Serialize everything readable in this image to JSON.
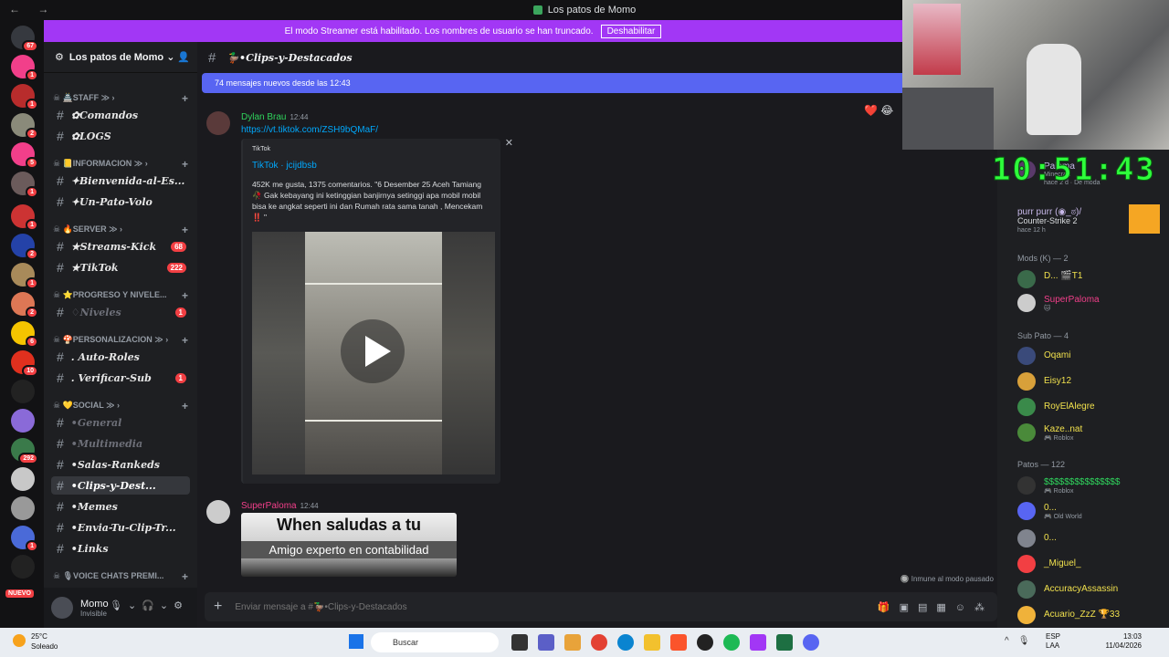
{
  "window": {
    "title": "Los patos de Momo",
    "nav": "← →"
  },
  "streamer_bar": {
    "text": "El modo Streamer está habilitado. Los nombres de usuario se han truncado.",
    "button": "Deshabilitar"
  },
  "server": {
    "name": "Los patos de Momo ⌄"
  },
  "guild_badges": [
    "67",
    "1",
    "1",
    "2",
    "5",
    "1",
    "1",
    "2",
    "1",
    "2",
    "6",
    "10",
    "292",
    "1"
  ],
  "guild_new": "NUEVO",
  "categories": [
    {
      "label": "☠ 🏯STAFF ≫ ›"
    },
    {
      "label": "☠ 📒INFORMACION ≫ ›"
    },
    {
      "label": "☠ 🔥SERVER ≫ ›"
    },
    {
      "label": "☠ ⭐PROGRESO Y NIVELE..."
    },
    {
      "label": "☠ 🍄PERSONALIZACION ≫ ›"
    },
    {
      "label": "☠ 💛SOCIAL ≫ ›"
    },
    {
      "label": "☠ 🎙VOICE CHATS PREMI..."
    }
  ],
  "channels": [
    {
      "label": "✿Comandos",
      "count": ""
    },
    {
      "label": "✿LOGS",
      "count": ""
    },
    {
      "label": "✦Bienvenida-al-Es...",
      "count": ""
    },
    {
      "label": "✦Un-Pato-Volo",
      "count": ""
    },
    {
      "label": "★Streams-Kick",
      "count": "68"
    },
    {
      "label": "★TikTok",
      "count": "222"
    },
    {
      "label": "♢Niveles",
      "count": "1"
    },
    {
      "label": ". Auto-Roles",
      "count": ""
    },
    {
      "label": ". Verificar-Sub",
      "count": "1"
    },
    {
      "label": "•General",
      "count": ""
    },
    {
      "label": "•Multimedia",
      "count": ""
    },
    {
      "label": "•Salas-Rankeds",
      "count": ""
    },
    {
      "label": "•Clips-y-Dest...",
      "count": ""
    },
    {
      "label": "•Memes",
      "count": ""
    },
    {
      "label": "•Envia-Tu-Clip-Tr...",
      "count": ""
    },
    {
      "label": "•Links",
      "count": ""
    }
  ],
  "user": {
    "name": "Momo",
    "status": "Invisible"
  },
  "chat": {
    "channel": "🦆•Clips-y-Destacados",
    "new_messages": "74 mensajes nuevos desde las 12:43",
    "msg1": {
      "author": "Dylan Brau",
      "time": "12:44",
      "link": "https://vt.tiktok.com/ZSH9bQMaF/",
      "provider": "TikTok",
      "embed_title": "TikTok · jcijdbsb",
      "embed_desc": "452K me gusta, 1375 comentarios. \"6 Desember 25 Aceh Tamiang 🥀 Gak kebayang ini ketinggian banjirnya setinggi apa mobil mobil bisa ke angkat seperti ini dan Rumah rata sama tanah , Mencekam ‼️ \""
    },
    "msg2": {
      "author": "SuperPaloma",
      "time": "12:44",
      "meme_line1": "When saludas a tu",
      "meme_line2": "Amigo experto en contabilidad"
    },
    "reactions": "❤️ 😂",
    "immune": "🔘 Inmune al modo pausado",
    "composer_placeholder": "Enviar mensaje a #🦆•Clips-y-Destacados"
  },
  "clock": "10:51:43",
  "members": {
    "top": [
      {
        "name": "Paloma",
        "sub": "Minecraft",
        "sub2": "hace 2 d · De moda"
      },
      {
        "name": "purr purr (◉_ಠ)/",
        "sub": "Counter-Strike 2",
        "sub2": "hace 12 h"
      }
    ],
    "groups": [
      {
        "title": "Mods (K) — 2",
        "items": [
          {
            "name": "D... 🎬T1",
            "sub": "",
            "color": "#f0e04d"
          },
          {
            "name": "SuperPaloma",
            "sub": "🐱",
            "color": "#f23f8a"
          }
        ]
      },
      {
        "title": "Sub Pato — 4",
        "items": [
          {
            "name": "Oqami",
            "sub": "",
            "color": "#f0e04d"
          },
          {
            "name": "Eisy12",
            "sub": "",
            "color": "#f0e04d"
          },
          {
            "name": "RoyElAlegre",
            "sub": "",
            "color": "#f0e04d"
          },
          {
            "name": "Kaze..nat",
            "sub": "🎮 Roblox",
            "color": "#f0e04d"
          }
        ]
      },
      {
        "title": "Patos — 122",
        "items": [
          {
            "name": "$$$$$$$$$$$$$$$",
            "sub": "🎮 Roblox",
            "color": "#2fd35c"
          },
          {
            "name": "0...",
            "sub": "🎮 Old World",
            "color": "#f0e04d"
          },
          {
            "name": "0...",
            "sub": "",
            "color": "#f0e04d"
          },
          {
            "name": "_Miguel_",
            "sub": "",
            "color": "#f0e04d"
          },
          {
            "name": "AccuracyAssassin",
            "sub": "",
            "color": "#f0e04d"
          },
          {
            "name": "Acuario_ZzZ 🏆33",
            "sub": "",
            "color": "#f0e04d"
          }
        ]
      }
    ]
  },
  "taskbar": {
    "temp": "25°C",
    "weather": "Soleado",
    "search": "Buscar",
    "lang1": "ESP",
    "lang2": "LAA",
    "time": "13:03",
    "date": "11/04/2026"
  }
}
